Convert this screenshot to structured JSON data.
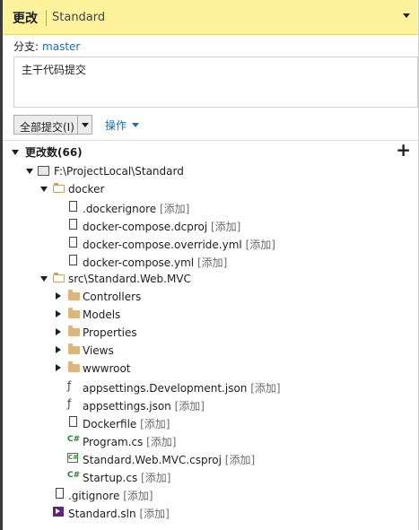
{
  "header": {
    "title": "更改",
    "subtitle": "Standard"
  },
  "branch": {
    "label": "分支:",
    "value": "master"
  },
  "commit_message": "主干代码提交",
  "commit_button": {
    "label": "全部提交(I)"
  },
  "actions": {
    "label": "操作"
  },
  "changes": {
    "label": "更改数(66)"
  },
  "tree": {
    "repo": "F:\\ProjectLocal\\Standard",
    "docker": "docker",
    "docker_files": [
      {
        "name": ".dockerignore",
        "tag": "[添加]"
      },
      {
        "name": "docker-compose.dcproj",
        "tag": "[添加]"
      },
      {
        "name": "docker-compose.override.yml",
        "tag": "[添加]"
      },
      {
        "name": "docker-compose.yml",
        "tag": "[添加]"
      }
    ],
    "src": "src\\Standard.Web.MVC",
    "folders": [
      "Controllers",
      "Models",
      "Properties",
      "Views",
      "wwwroot"
    ],
    "src_files": [
      {
        "name": "appsettings.Development.json",
        "tag": "[添加]"
      },
      {
        "name": "appsettings.json",
        "tag": "[添加]"
      },
      {
        "name": "Dockerfile",
        "tag": "[添加]"
      },
      {
        "name": "Program.cs",
        "tag": "[添加]"
      },
      {
        "name": "Standard.Web.MVC.csproj",
        "tag": "[添加]"
      },
      {
        "name": "Startup.cs",
        "tag": "[添加]"
      }
    ],
    "root_files": [
      {
        "name": ".gitignore",
        "tag": "[添加]"
      },
      {
        "name": "Standard.sln",
        "tag": "[添加]"
      }
    ]
  }
}
